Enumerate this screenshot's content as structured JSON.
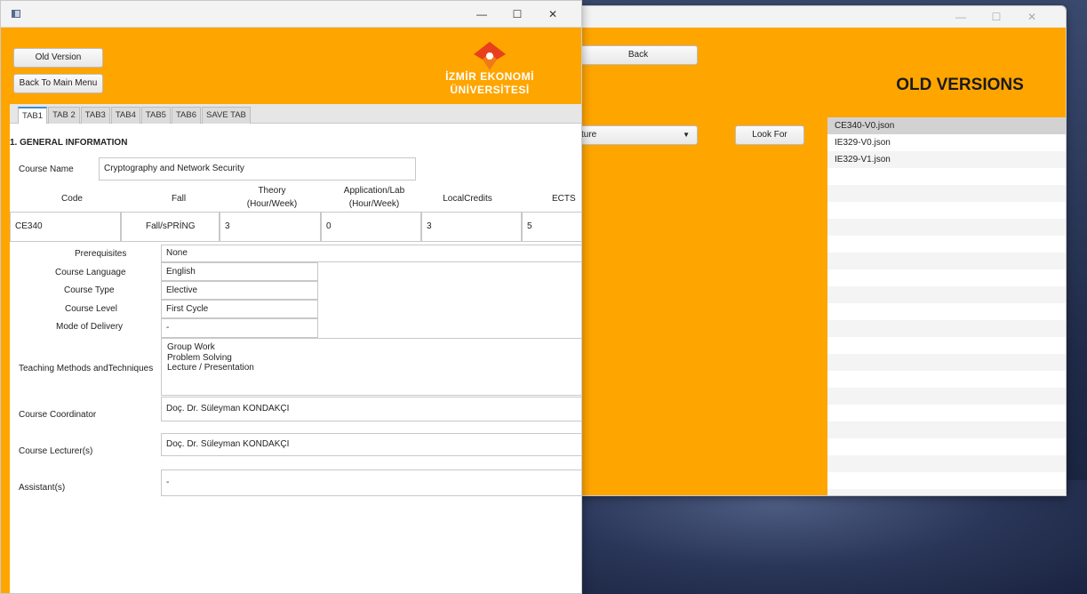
{
  "old_versions_window": {
    "back_label": "Back",
    "title": "OLD VERSIONS",
    "combo_value": "cture",
    "look_for_label": "Look For",
    "files": [
      "CE340-V0.json",
      "IE329-V0.json",
      "IE329-V1.json"
    ],
    "selected_file": "CE340-V0.json"
  },
  "main_window": {
    "old_version_label": "Old Version",
    "back_to_main_label": "Back To Main Menu",
    "logo_line1": "İZMİR EKONOMİ",
    "logo_line2": "ÜNİVERSİTESİ",
    "tabs": [
      "TAB1",
      "TAB 2",
      "TAB3",
      "TAB4",
      "TAB5",
      "TAB6",
      "SAVE TAB"
    ],
    "active_tab": "TAB1",
    "section_title": "1. GENERAL INFORMATION",
    "course_name_label": "Course Name",
    "course_name_value": "Cryptography and Network Security",
    "headers": {
      "code": "Code",
      "semester": "Fall",
      "theory": "Theory\n(Hour/Week)",
      "application": "Application/Lab\n(Hour/Week)",
      "local_credits": "LocalCredits",
      "ects": "ECTS"
    },
    "values": {
      "code": "CE340",
      "semester": "Fall/sPRİNG",
      "theory": "3",
      "application": "0",
      "local_credits": "3",
      "ects": "5"
    },
    "prerequisites_label": "Prerequisites",
    "prerequisites_value": "None",
    "language_label": "Course Language",
    "language_value": "English",
    "type_label": "Course Type",
    "type_value": "Elective",
    "level_label": "Course Level",
    "level_value": "First Cycle",
    "delivery_label": "Mode of Delivery",
    "delivery_value": "-",
    "teaching_label": "Teaching Methods andTechniques",
    "teaching_value": "Group Work\nProblem Solving\nLecture / Presentation",
    "coordinator_label": "Course Coordinator",
    "coordinator_value": "Doç. Dr. Süleyman KONDAKÇI",
    "lecturer_label": "Course Lecturer(s)",
    "lecturer_value": "Doç. Dr. Süleyman KONDAKÇI",
    "assistant_label": "Assistant(s)",
    "assistant_value": "-"
  },
  "window_controls": {
    "minimize": "—",
    "maximize": "☐",
    "close": "✕"
  },
  "colors": {
    "accent": "#ffa500",
    "logo_red": "#e8401c"
  }
}
